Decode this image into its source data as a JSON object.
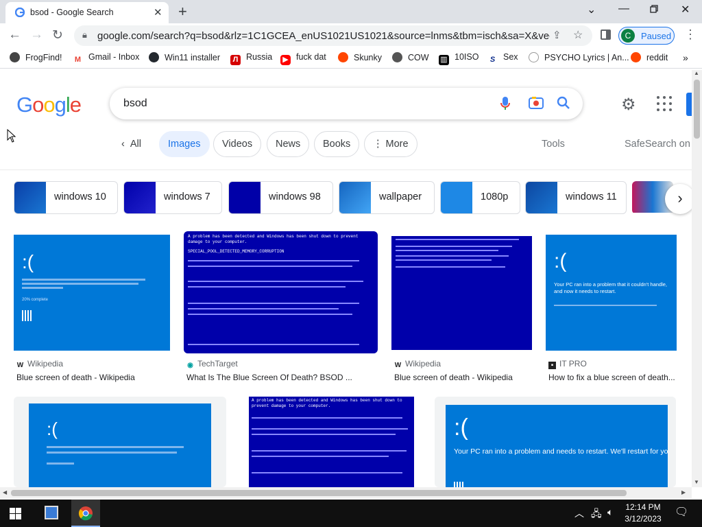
{
  "browser": {
    "tab_title": "bsod - Google Search",
    "url": "google.com/search?q=bsod&rlz=1C1GCEA_enUS1021US1021&source=lnms&tbm=isch&sa=X&ved=2...",
    "profile_initial": "C",
    "profile_label": "Paused"
  },
  "bookmarks": [
    {
      "label": "FrogFind!",
      "icon": "globe-icon"
    },
    {
      "label": "Gmail - Inbox",
      "icon": "gmail-icon"
    },
    {
      "label": "Win11 installer",
      "icon": "github-icon"
    },
    {
      "label": "Russia",
      "icon": "flag-icon"
    },
    {
      "label": "fuck dat",
      "icon": "youtube-icon"
    },
    {
      "label": "Skunky",
      "icon": "reddit-icon"
    },
    {
      "label": "COW",
      "icon": "globe-icon"
    },
    {
      "label": "10ISO",
      "icon": "building-icon"
    },
    {
      "label": "Sex",
      "icon": "s-logo-icon"
    },
    {
      "label": "PSYCHO Lyrics | An...",
      "icon": "circle-icon"
    },
    {
      "label": "reddit",
      "icon": "reddit-icon"
    }
  ],
  "google": {
    "logo": [
      "G",
      "o",
      "o",
      "g",
      "l",
      "e"
    ],
    "query": "bsod",
    "filters": [
      "All",
      "Images",
      "Videos",
      "News",
      "Books",
      "More"
    ],
    "tools": "Tools",
    "safesearch": "SafeSearch on"
  },
  "related": [
    "windows 10",
    "windows 7",
    "windows 98",
    "wallpaper",
    "1080p",
    "windows 11"
  ],
  "results": [
    {
      "source": "Wikipedia",
      "caption": "Blue screen of death - Wikipedia"
    },
    {
      "source": "TechTarget",
      "caption": "What Is The Blue Screen Of Death? BSOD ..."
    },
    {
      "source": "Wikipedia",
      "caption": "Blue screen of death - Wikipedia"
    },
    {
      "source": "IT PRO",
      "caption": "How to fix a blue screen of death..."
    }
  ],
  "bsod_text": {
    "face": ":(",
    "restart_a": "Your PC ran into a problem and needs to restart. We'll restart for you.",
    "problem_b": "Your PC ran into a problem that it couldn't handle, and now it needs to restart.",
    "old_header": "A problem has been detected and Windows has been shut down to prevent damage to your computer.",
    "old_code": "SPECIAL_POOL_DETECTED_MEMORY_CORRUPTION",
    "percent": "20% complete"
  },
  "taskbar": {
    "time": "12:14 PM",
    "date": "3/12/2023"
  }
}
